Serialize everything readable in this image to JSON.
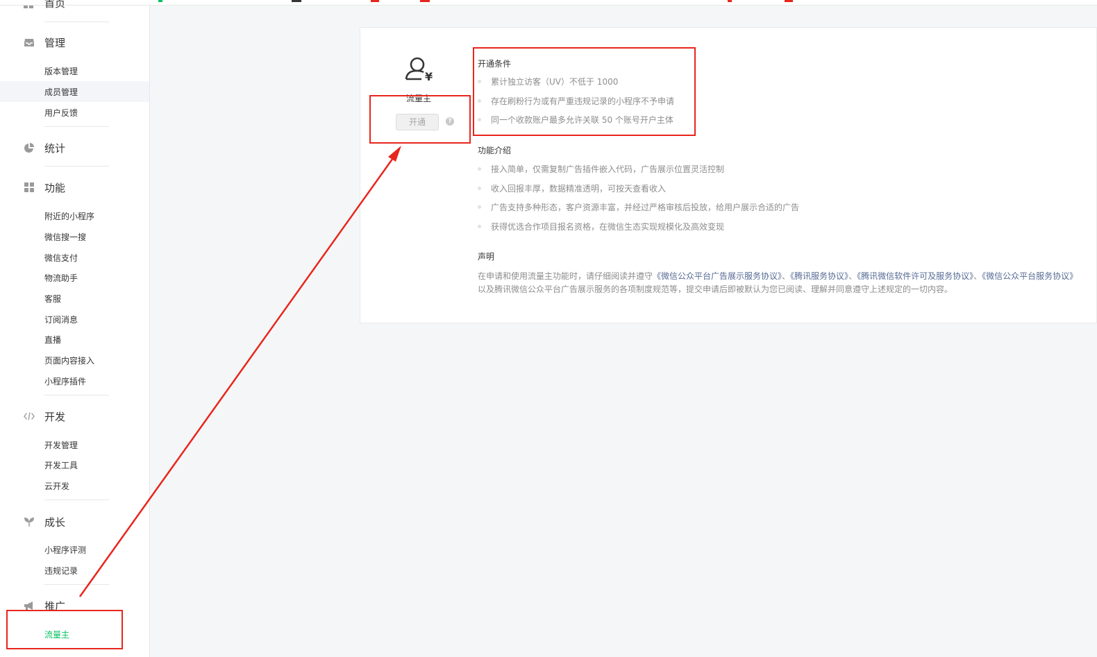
{
  "sidebar": {
    "cut_title": "首页",
    "sections": [
      {
        "title": "管理",
        "icon": "inbox-icon",
        "items": [
          "版本管理",
          "成员管理",
          "用户反馈"
        ]
      },
      {
        "title": "统计",
        "icon": "pie-chart-icon",
        "items": []
      },
      {
        "title": "功能",
        "icon": "grid-icon",
        "items": [
          "附近的小程序",
          "微信搜一搜",
          "微信支付",
          "物流助手",
          "客服",
          "订阅消息",
          "直播",
          "页面内容接入",
          "小程序插件"
        ]
      },
      {
        "title": "开发",
        "icon": "code-icon",
        "items": [
          "开发管理",
          "开发工具",
          "云开发"
        ]
      },
      {
        "title": "成长",
        "icon": "sprout-icon",
        "items": [
          "小程序评测",
          "违规记录"
        ]
      },
      {
        "title": "推广",
        "icon": "megaphone-icon",
        "items": [
          "流量主"
        ]
      }
    ]
  },
  "card": {
    "role_name": "流量主",
    "open_button": "开通",
    "conditions_title": "开通条件",
    "conditions": [
      "累计独立访客（UV）不低于 1000",
      "存在刷粉行为或有严重违规记录的小程序不予申请",
      "同一个收款账户最多允许关联 50 个账号开户主体"
    ],
    "features_title": "功能介绍",
    "features": [
      "接入简单，仅需复制广告插件嵌入代码，广告展示位置灵活控制",
      "收入回报丰厚，数据精准透明，可按天查看收入",
      "广告支持多种形态，客户资源丰富，并经过严格审核后投放，给用户展示合适的广告",
      "获得优选合作项目报名资格，在微信生态实现规模化及高效变现"
    ],
    "declare_title": "声明",
    "declare": {
      "prefix": "在申请和使用流量主功能时，请仔细阅读并遵守",
      "link1": "《微信公众平台广告展示服务协议》",
      "sep1": "、",
      "link2": "《腾讯服务协议》",
      "sep2": "、",
      "link3": "《腾讯微信软件许可及服务协议》",
      "sep3": "、",
      "link4": "《微信公众平台服务协议》",
      "suffix": "以及腾讯微信公众平台广告展示服务的各项制度规范等，提交申请后即被默认为您已阅读、理解并同意遵守上述规定的一切内容。"
    }
  },
  "colors": {
    "active_green": "#07c160",
    "annotation_red": "#e8251c",
    "link_blue": "#576b95"
  }
}
